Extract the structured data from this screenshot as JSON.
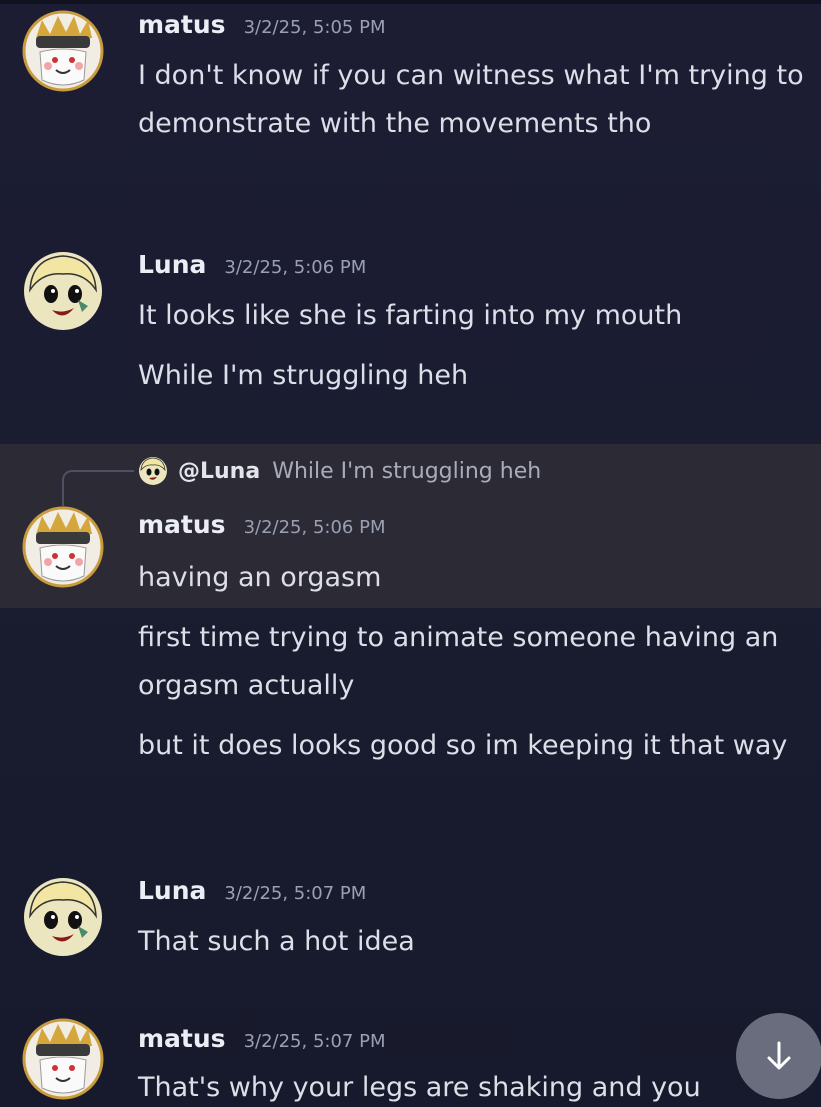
{
  "messages": [
    {
      "author": "matus",
      "timestamp": "3/2/25, 5:05 PM",
      "lines": [
        "I don't know if you can witness what I'm trying to demonstrate with the movements tho"
      ]
    },
    {
      "author": "Luna",
      "timestamp": "3/2/25, 5:06 PM",
      "lines": [
        "It looks like she is farting into my mouth",
        "While I'm struggling heh"
      ]
    },
    {
      "reply": {
        "mention": "@Luna",
        "text": "While I'm struggling heh"
      },
      "author": "matus",
      "timestamp": "3/2/25, 5:06 PM",
      "lines": [
        "having an orgasm",
        "first time trying to animate someone having an orgasm actually",
        "but it does looks good so im keeping it that way"
      ]
    },
    {
      "author": "Luna",
      "timestamp": "3/2/25, 5:07 PM",
      "lines": [
        "That such a hot idea"
      ]
    },
    {
      "author": "matus",
      "timestamp": "3/2/25, 5:07 PM",
      "lines": [
        "That's why your legs are shaking and you"
      ]
    }
  ],
  "icons": {
    "scroll_button": "arrow-down-icon",
    "matus_avatar": "avatar-white-haired-character",
    "luna_avatar": "avatar-blonde-character"
  },
  "colors": {
    "background": "#1c1d33",
    "highlight": "#2c2b35",
    "username": "#eceef5",
    "message": "#dcdfe8",
    "timestamp": "#9aa0b3"
  }
}
